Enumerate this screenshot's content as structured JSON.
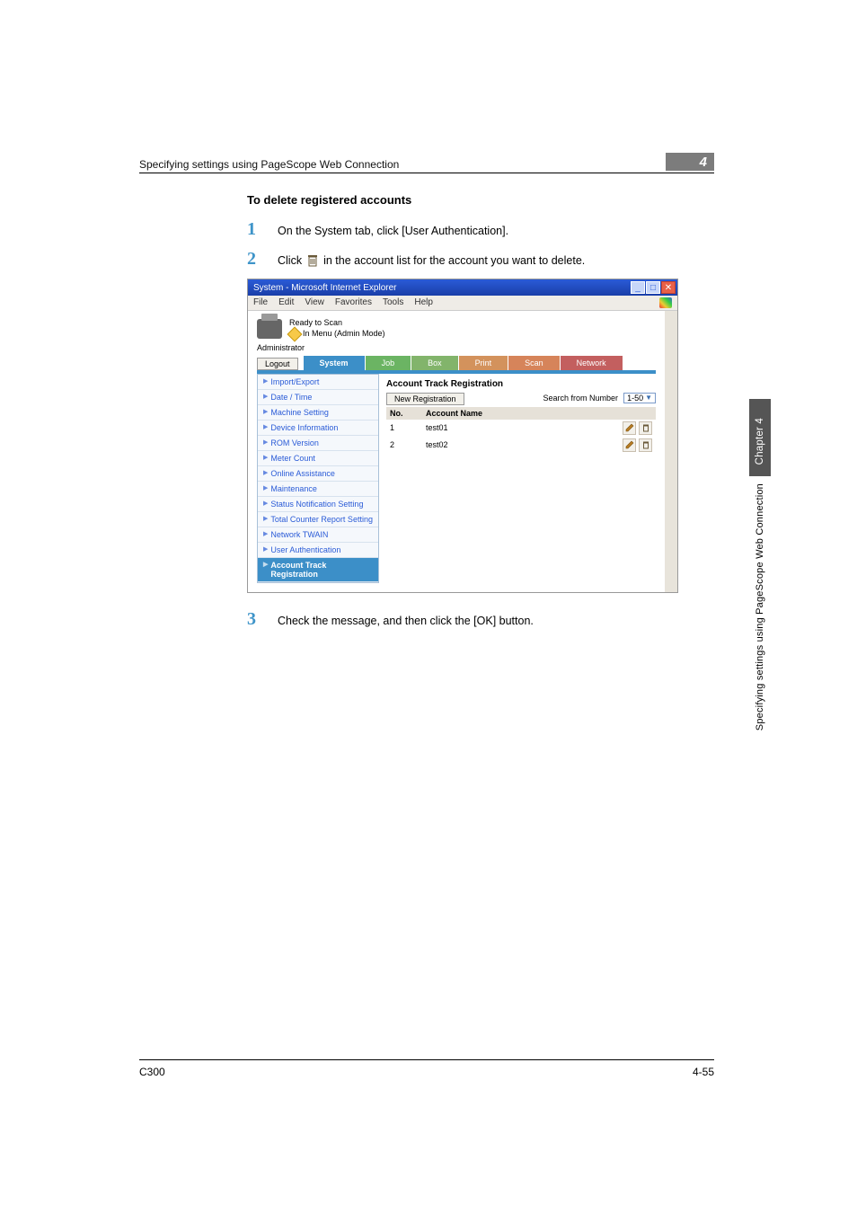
{
  "header": {
    "breadcrumb": "Specifying settings using PageScope Web Connection",
    "section_number": "4"
  },
  "heading": "To delete registered accounts",
  "steps": {
    "s1": {
      "num": "1",
      "text": "On the System tab, click [User Authentication]."
    },
    "s2": {
      "num": "2",
      "prefix": "Click ",
      "suffix": " in the account list for the account you want to delete."
    },
    "s3": {
      "num": "3",
      "text": "Check the message, and then click the [OK] button."
    }
  },
  "ie": {
    "title": "System - Microsoft Internet Explorer",
    "menus": [
      "File",
      "Edit",
      "View",
      "Favorites",
      "Tools",
      "Help"
    ],
    "status1": "Ready to Scan",
    "status2": "In Menu (Admin Mode)",
    "admin_label": "Administrator",
    "logout": "Logout",
    "tabs": {
      "system": "System",
      "job": "Job",
      "box": "Box",
      "print": "Print",
      "scan": "Scan",
      "network": "Network"
    },
    "sidebar": [
      "Import/Export",
      "Date / Time",
      "Machine Setting",
      "Device Information",
      "ROM Version",
      "Meter Count",
      "Online Assistance",
      "Maintenance",
      "Status Notification Setting",
      "Total Counter Report Setting",
      "Network TWAIN",
      "User Authentication",
      "Account Track Registration"
    ],
    "right": {
      "title": "Account Track Registration",
      "new_reg": "New Registration",
      "search_label": "Search from Number",
      "range": "1-50",
      "col_no": "No.",
      "col_name": "Account Name",
      "rows": [
        {
          "no": "1",
          "name": "test01"
        },
        {
          "no": "2",
          "name": "test02"
        }
      ]
    }
  },
  "side": {
    "chapter": "Chapter 4",
    "title": "Specifying settings using PageScope Web Connection"
  },
  "footer": {
    "left": "C300",
    "right": "4-55"
  }
}
